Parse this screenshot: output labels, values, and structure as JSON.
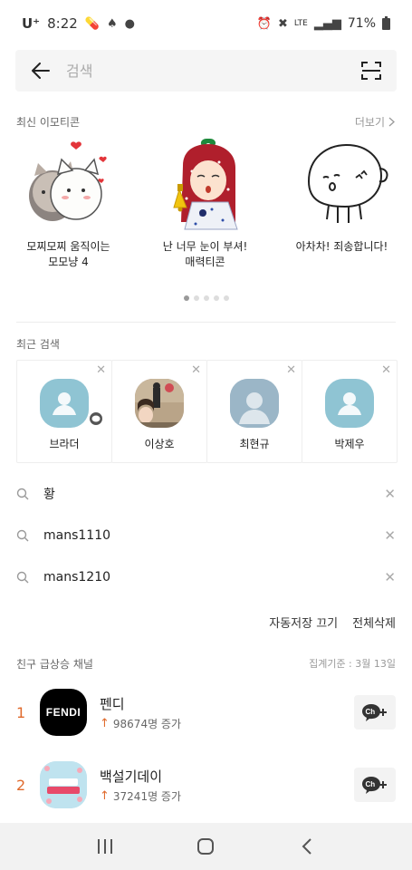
{
  "status_bar": {
    "carrier": "U⁺",
    "time": "8:22",
    "lte": "LTE",
    "battery": "71%"
  },
  "search": {
    "placeholder": "검색",
    "value": ""
  },
  "recent_emoticons": {
    "title": "최신 이모티콘",
    "more_label": "더보기",
    "items": [
      {
        "label": "모찌모찌 움직이는\n모모냥 4",
        "icon": "cat-couple-emoticon"
      },
      {
        "label": "난 너무 눈이 부셔!\n매력티콘",
        "icon": "girl-bell-emoticon"
      },
      {
        "label": "아차차! 죄송합니다!",
        "icon": "blob-sorry-emoticon"
      }
    ],
    "page_count": 5,
    "active_page": 0
  },
  "recent_search": {
    "title": "최근 검색",
    "people": [
      {
        "name": "브라더",
        "avatar": "default",
        "has_chat_badge": true
      },
      {
        "name": "이상호",
        "avatar": "photo",
        "has_chat_badge": false
      },
      {
        "name": "최현규",
        "avatar": "photo-default",
        "has_chat_badge": false
      },
      {
        "name": "박제우",
        "avatar": "default",
        "has_chat_badge": false
      }
    ],
    "keywords": [
      "황",
      "mans1110",
      "mans1210"
    ],
    "actions": {
      "autosave_off": "자동저장 끄기",
      "delete_all": "전체삭제"
    }
  },
  "rising_channels": {
    "title": "친구 급상승 채널",
    "basis": "집계기준 : 3월 13일",
    "items": [
      {
        "rank": "1",
        "name": "펜디",
        "stat": "98674명 증가",
        "logo_text": "FENDI",
        "logo_color": "#000000"
      },
      {
        "rank": "2",
        "name": "백설기데이",
        "stat": "37241명 증가",
        "logo_text": "3월 14일 백설기데이",
        "logo_color": "#bfe3ef"
      }
    ]
  },
  "colors": {
    "accent": "#e06a2c",
    "avatar_default": "#8fc4d3"
  }
}
